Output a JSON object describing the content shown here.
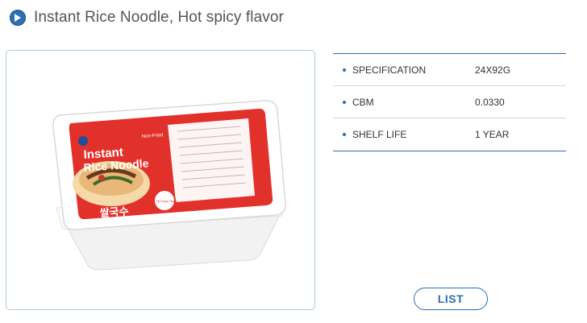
{
  "page": {
    "title": "Instant Rice Noodle,  Hot spicy flavor",
    "title_icon": "play-circle-icon"
  },
  "product_image": {
    "alt": "Instant Rice Noodle",
    "package_texts": [
      "Instant",
      "Rice Noodle",
      "Non-Fried",
      "쌀국수",
      "Hot Spicy Flavor"
    ]
  },
  "specifications": [
    {
      "label": "SPECIFICATION",
      "value": "24X92G"
    },
    {
      "label": "CBM",
      "value": "0.0330"
    },
    {
      "label": "SHELF LIFE",
      "value": "1 YEAR"
    }
  ],
  "list_button": {
    "label": "LIST"
  },
  "colors": {
    "accent": "#2d6fb0",
    "border": "#aacbe0",
    "package_red": "#e2312a"
  }
}
